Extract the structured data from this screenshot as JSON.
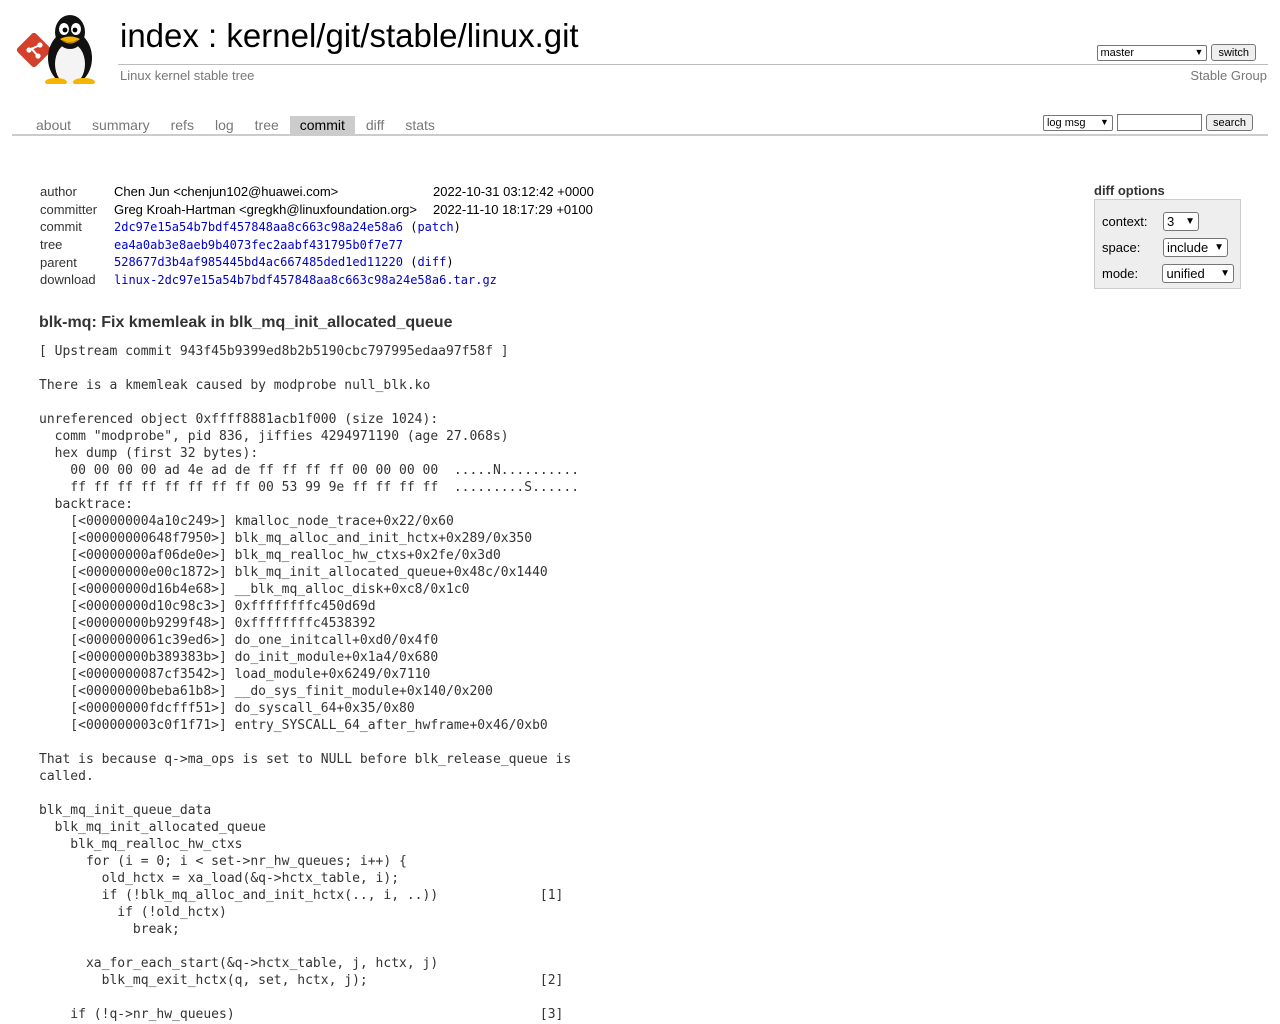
{
  "header": {
    "title_index": "index",
    "title_sep": " : ",
    "title_repo": "kernel/git/stable/linux.git",
    "description": "Linux kernel stable tree",
    "owner": "Stable Group",
    "branch_selected": "master",
    "switch_label": "switch"
  },
  "tabs": [
    {
      "label": "about"
    },
    {
      "label": "summary"
    },
    {
      "label": "refs"
    },
    {
      "label": "log"
    },
    {
      "label": "tree"
    },
    {
      "label": "commit",
      "active": true
    },
    {
      "label": "diff"
    },
    {
      "label": "stats"
    }
  ],
  "search": {
    "mode_selected": "log msg",
    "query": "",
    "button_label": "search"
  },
  "diff_options": {
    "title": "diff options",
    "context_label": "context:",
    "context_value": "3",
    "space_label": "space:",
    "space_value": "include",
    "mode_label": "mode:",
    "mode_value": "unified"
  },
  "commit_info": {
    "author_label": "author",
    "author": "Chen Jun <chenjun102@huawei.com>",
    "author_date": "2022-10-31 03:12:42 +0000",
    "committer_label": "committer",
    "committer": "Greg Kroah-Hartman <gregkh@linuxfoundation.org>",
    "committer_date": "2022-11-10 18:17:29 +0100",
    "commit_label": "commit",
    "commit_hash": "2dc97e15a54b7bdf457848aa8c663c98a24e58a6",
    "patch_link": "patch",
    "tree_label": "tree",
    "tree_hash": "ea4a0ab3e8aeb9b4073fec2aabf431795b0f7e77",
    "parent_label": "parent",
    "parent_hash": "528677d3b4af985445bd4ac667485ded1ed11220",
    "diff_link": "diff",
    "download_label": "download",
    "download_file": "linux-2dc97e15a54b7bdf457848aa8c663c98a24e58a6.tar.gz"
  },
  "commit_subject": "blk-mq: Fix kmemleak in blk_mq_init_allocated_queue",
  "commit_message": "[ Upstream commit 943f45b9399ed8b2b5190cbc797995edaa97f58f ]\n\nThere is a kmemleak caused by modprobe null_blk.ko\n\nunreferenced object 0xffff8881acb1f000 (size 1024):\n  comm \"modprobe\", pid 836, jiffies 4294971190 (age 27.068s)\n  hex dump (first 32 bytes):\n    00 00 00 00 ad 4e ad de ff ff ff ff 00 00 00 00  .....N..........\n    ff ff ff ff ff ff ff ff 00 53 99 9e ff ff ff ff  .........S......\n  backtrace:\n    [<000000004a10c249>] kmalloc_node_trace+0x22/0x60\n    [<00000000648f7950>] blk_mq_alloc_and_init_hctx+0x289/0x350\n    [<00000000af06de0e>] blk_mq_realloc_hw_ctxs+0x2fe/0x3d0\n    [<00000000e00c1872>] blk_mq_init_allocated_queue+0x48c/0x1440\n    [<00000000d16b4e68>] __blk_mq_alloc_disk+0xc8/0x1c0\n    [<00000000d10c98c3>] 0xffffffffc450d69d\n    [<00000000b9299f48>] 0xffffffffc4538392\n    [<0000000061c39ed6>] do_one_initcall+0xd0/0x4f0\n    [<00000000b389383b>] do_init_module+0x1a4/0x680\n    [<0000000087cf3542>] load_module+0x6249/0x7110\n    [<00000000beba61b8>] __do_sys_finit_module+0x140/0x200\n    [<00000000fdcfff51>] do_syscall_64+0x35/0x80\n    [<000000003c0f1f71>] entry_SYSCALL_64_after_hwframe+0x46/0xb0\n\nThat is because q->ma_ops is set to NULL before blk_release_queue is\ncalled.\n\nblk_mq_init_queue_data\n  blk_mq_init_allocated_queue\n    blk_mq_realloc_hw_ctxs\n      for (i = 0; i < set->nr_hw_queues; i++) {\n        old_hctx = xa_load(&q->hctx_table, i);\n        if (!blk_mq_alloc_and_init_hctx(.., i, ..))             [1]\n          if (!old_hctx)\n            break;\n\n      xa_for_each_start(&q->hctx_table, j, hctx, j)\n        blk_mq_exit_hctx(q, set, hctx, j);                      [2]\n\n    if (!q->nr_hw_queues)                                       [3]"
}
